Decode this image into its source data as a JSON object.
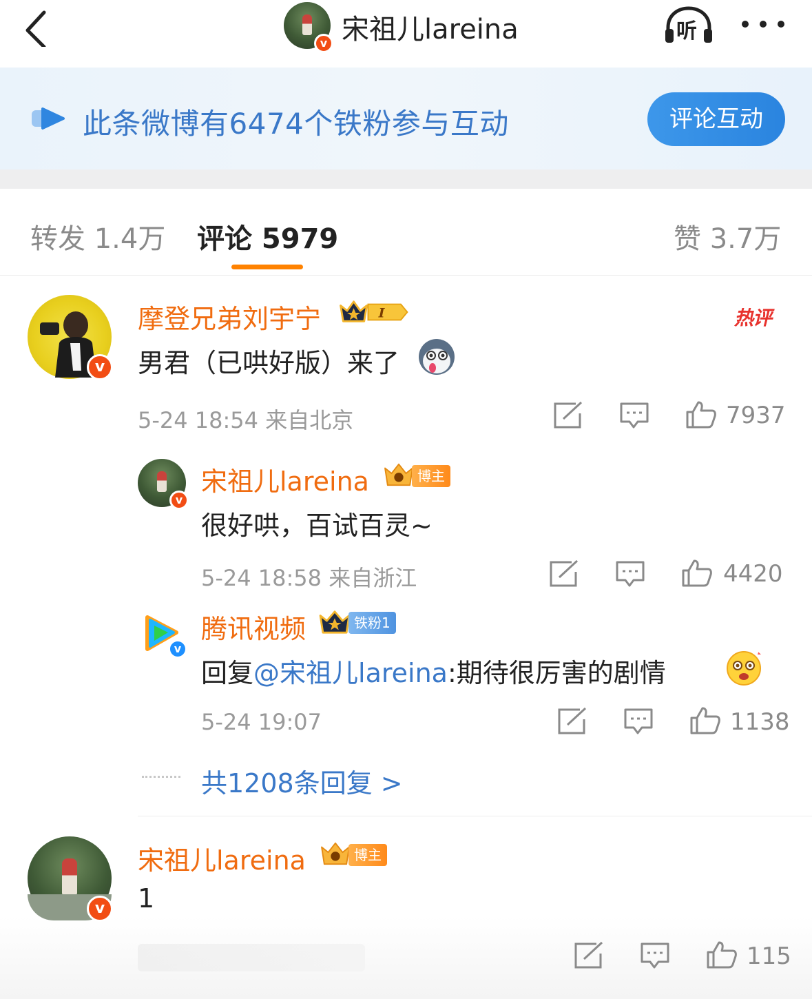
{
  "header": {
    "title": "宋祖儿lareina",
    "back_icon": "chevron-left-icon",
    "listen_label": "听",
    "more_icon": "more-dots-icon"
  },
  "banner": {
    "text": "此条微博有6474个铁粉参与互动",
    "button_label": "评论互动"
  },
  "tabs": [
    {
      "label": "转发 1.4万",
      "active": false
    },
    {
      "label": "评论 5979",
      "active": true
    },
    {
      "label": "赞 3.7万",
      "active": false
    }
  ],
  "colors": {
    "accent": "#ff8200",
    "name": "#f06c10",
    "link": "#3a78c8",
    "verified": "#f24d14"
  },
  "comments": [
    {
      "name": "摩登兄弟刘宇宁",
      "badge_level": "I",
      "hot_label": "热评",
      "text": "男君（已哄好版）来了",
      "time": "5-24 18:54 来自北京",
      "likes": "7937",
      "replies": [
        {
          "name": "宋祖儿lareina",
          "tag": "博主",
          "text": "很好哄，百试百灵~",
          "time": "5-24 18:58 来自浙江",
          "likes": "4420"
        },
        {
          "name": "腾讯视频",
          "tag": "铁粉1",
          "text_prefix": "回复",
          "mention": "@宋祖儿lareina",
          "text": ":期待很厉害的剧情",
          "time": "5-24 19:07",
          "likes": "1138"
        }
      ],
      "more_replies": "共1208条回复 >"
    },
    {
      "name": "宋祖儿lareina",
      "tag": "博主",
      "text": "1",
      "likes": "115"
    }
  ]
}
